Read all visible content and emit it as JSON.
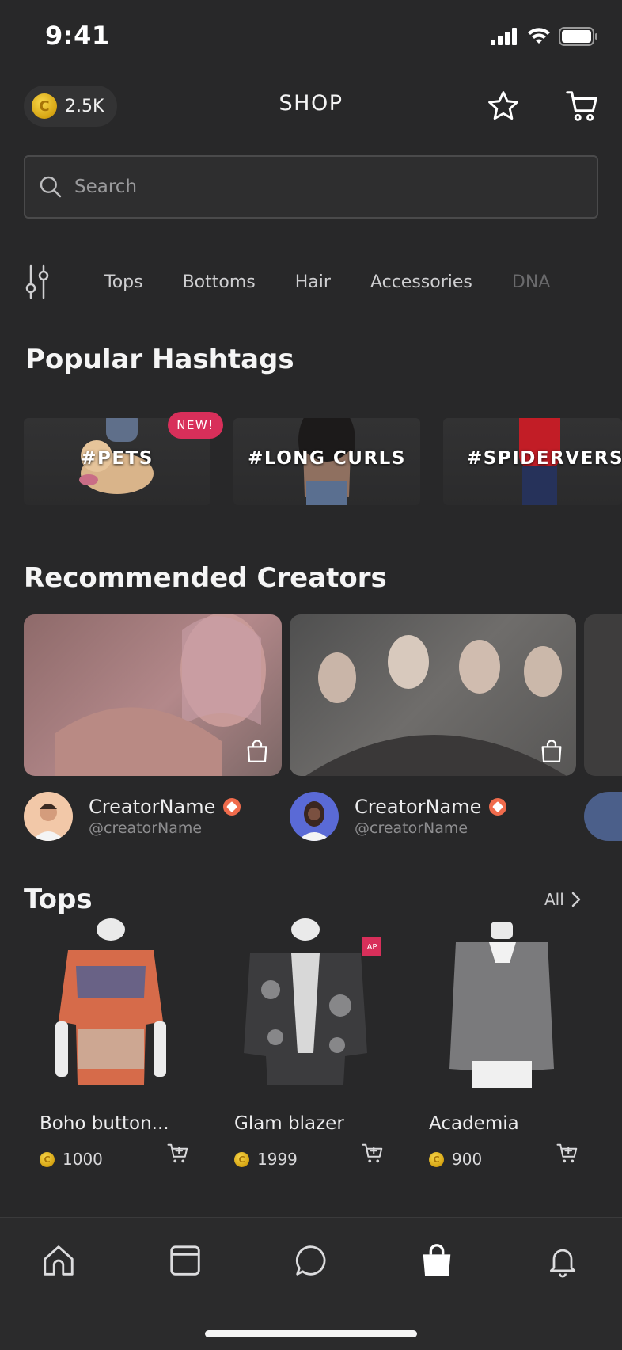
{
  "status_bar": {
    "time": "9:41"
  },
  "header": {
    "coins": "2.5K",
    "title": "SHOP"
  },
  "search": {
    "placeholder": "Search"
  },
  "categories": [
    "Tops",
    "Bottoms",
    "Hair",
    "Accessories",
    "DNA"
  ],
  "hashtags": {
    "title": "Popular Hashtags",
    "badge": "NEW!",
    "items": [
      {
        "label": "#PETS"
      },
      {
        "label": "#LONG CURLS"
      },
      {
        "label": "#SPIDERVERSE"
      }
    ]
  },
  "creators": {
    "title": "Recommended Creators",
    "items": [
      {
        "name": "CreatorName",
        "handle": "@creatorName"
      },
      {
        "name": "CreatorName",
        "handle": "@creatorName"
      }
    ]
  },
  "tops": {
    "title": "Tops",
    "all_label": "All",
    "ap_badge": "AP",
    "items": [
      {
        "name": "Boho button...",
        "price": "1000"
      },
      {
        "name": "Glam blazer",
        "price": "1999"
      },
      {
        "name": "Academia",
        "price": "900"
      }
    ]
  },
  "tabbar": {
    "items": [
      "home-icon",
      "browser-icon",
      "chat-icon",
      "shopping-bag-icon",
      "bell-icon"
    ],
    "active_index": 3
  },
  "colors": {
    "background": "#282829",
    "accent_badge": "#d82f5a",
    "coin": "#e0b01a"
  }
}
